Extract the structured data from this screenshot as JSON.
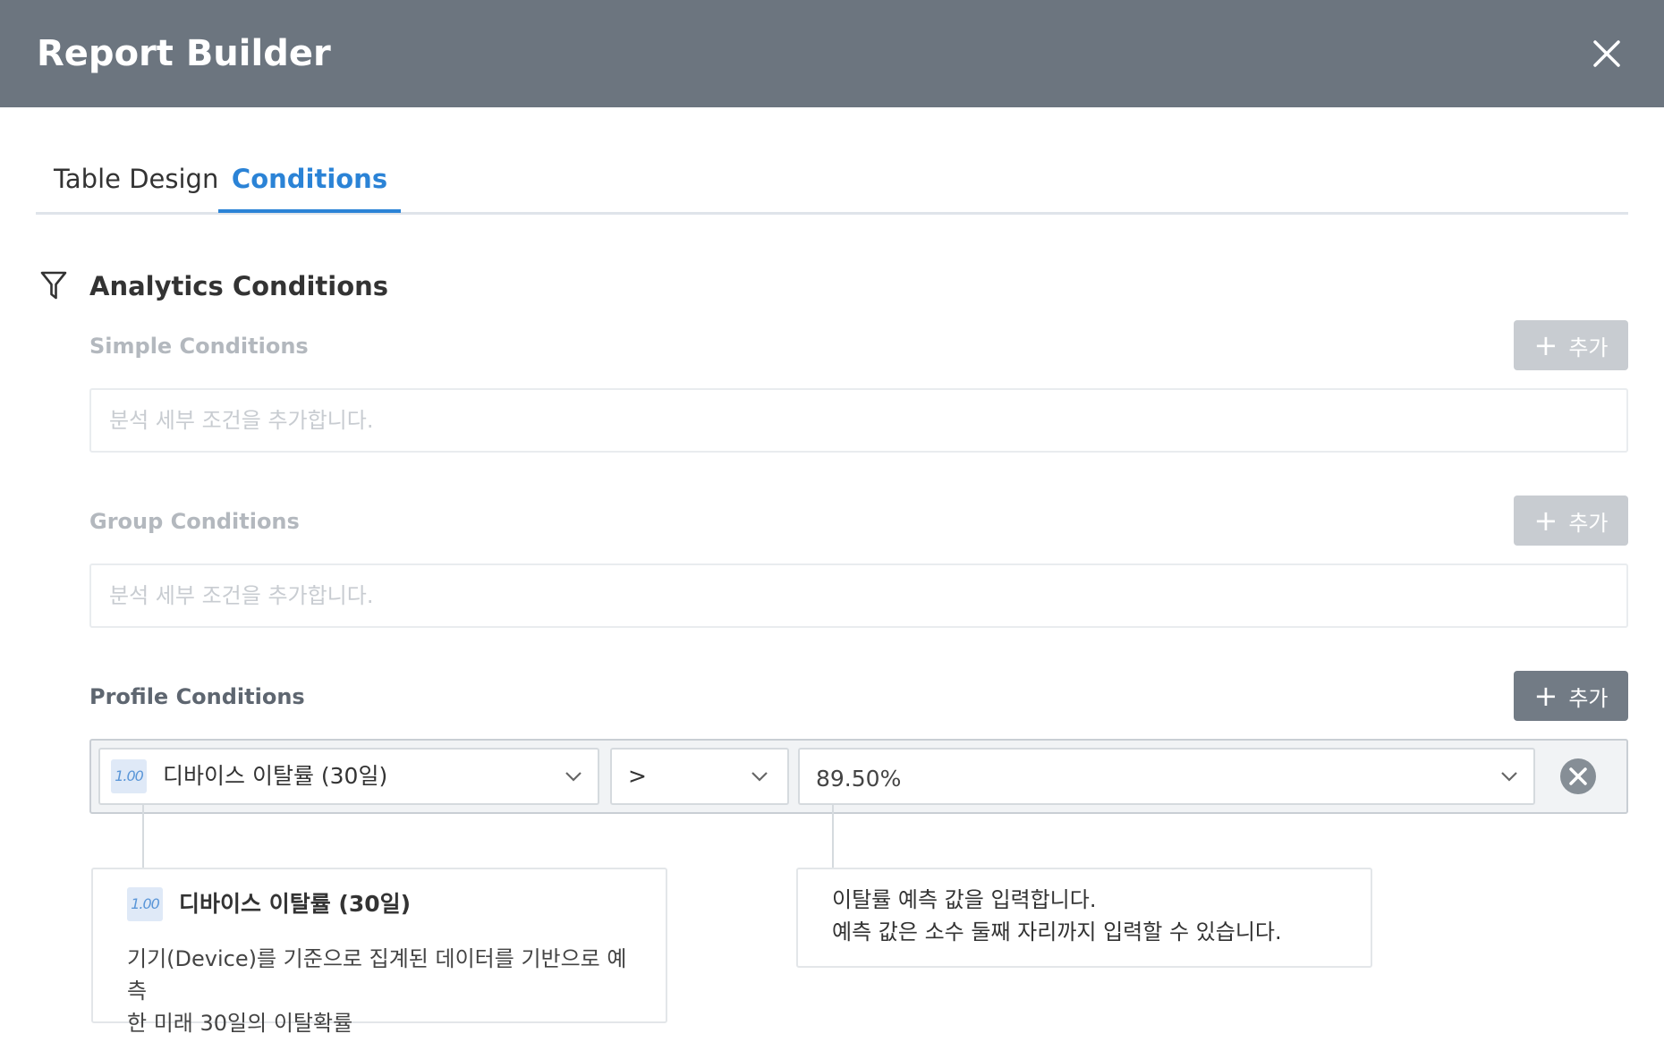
{
  "header": {
    "title": "Report Builder",
    "close_icon": "close-icon"
  },
  "tabs": [
    {
      "label": "Table Design",
      "active": false
    },
    {
      "label": "Conditions",
      "active": true
    }
  ],
  "section": {
    "icon": "filter-icon",
    "title": "Analytics Conditions"
  },
  "simple": {
    "title": "Simple Conditions",
    "add_label": "추가",
    "placeholder": "분석 세부 조건을 추가합니다."
  },
  "group": {
    "title": "Group Conditions",
    "add_label": "추가",
    "placeholder": "분석 세부 조건을 추가합니다."
  },
  "profile": {
    "title": "Profile Conditions",
    "add_label": "추가",
    "condition": {
      "type_badge": "1.00",
      "field": "디바이스 이탈률 (30일)",
      "operator": ">",
      "value": "89.50%"
    }
  },
  "tooltip_field": {
    "type_badge": "1.00",
    "title": "디바이스 이탈률 (30일)",
    "description_line1": "기기(Device)를 기준으로 집계된 데이터를 기반으로 예측",
    "description_line2": "한 미래 30일의 이탈확률"
  },
  "tooltip_value": {
    "line1": "이탈률 예측 값을 입력합니다.",
    "line2": "예측 값은 소수 둘째 자리까지 입력할 수 있습니다."
  },
  "colors": {
    "header_bg": "#6c757f",
    "accent": "#2b83d6",
    "add_disabled": "#c8ccd1",
    "add_enabled": "#727b85"
  }
}
